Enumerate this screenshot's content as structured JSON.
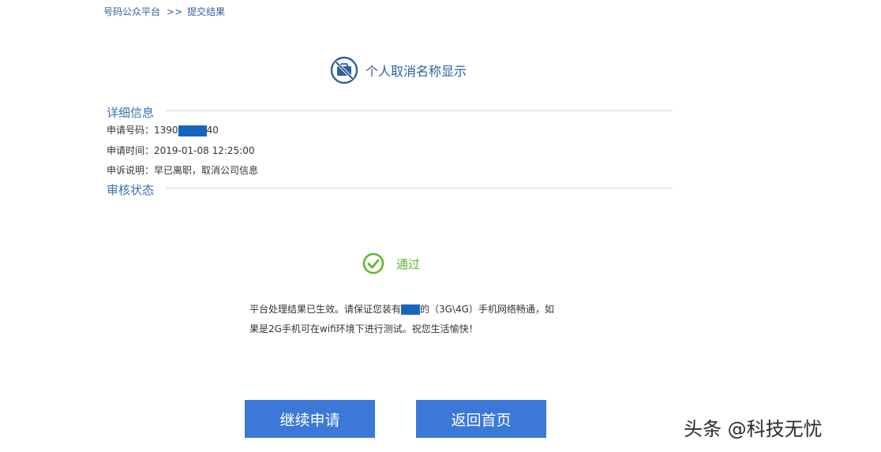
{
  "breadcrumb": {
    "root": "号码公众平台",
    "separator": ">>",
    "current": "提交结果"
  },
  "heading": {
    "icon": "briefcase-prohibited-icon",
    "title": "个人取消名称显示"
  },
  "details": {
    "section_title": "详细信息",
    "phone_label": "申请号码：",
    "phone_prefix": "1390",
    "phone_suffix": "40",
    "time_label": "申请时间：",
    "time_value": "2019-01-08 12:25:00",
    "reason_label": "申诉说明：",
    "reason_value": "早已离职，取消公司信息"
  },
  "review": {
    "section_title": "审核状态"
  },
  "status": {
    "icon": "check-circle-icon",
    "text": "通过",
    "color": "#5cb82f"
  },
  "result": {
    "line1_before": "平台处理结果已生效。请保证您装有",
    "line1_after": "的（3G\\4G）手机网络畅通，如",
    "line2": "果是2G手机可在wifi环境下进行测试。祝您生活愉快！"
  },
  "buttons": {
    "continue": "继续申请",
    "home": "返回首页"
  },
  "watermark": "头条 @科技无忧",
  "colors": {
    "accent": "#3b78d8",
    "heading": "#2f5f9e",
    "mask": "#1565c0"
  }
}
